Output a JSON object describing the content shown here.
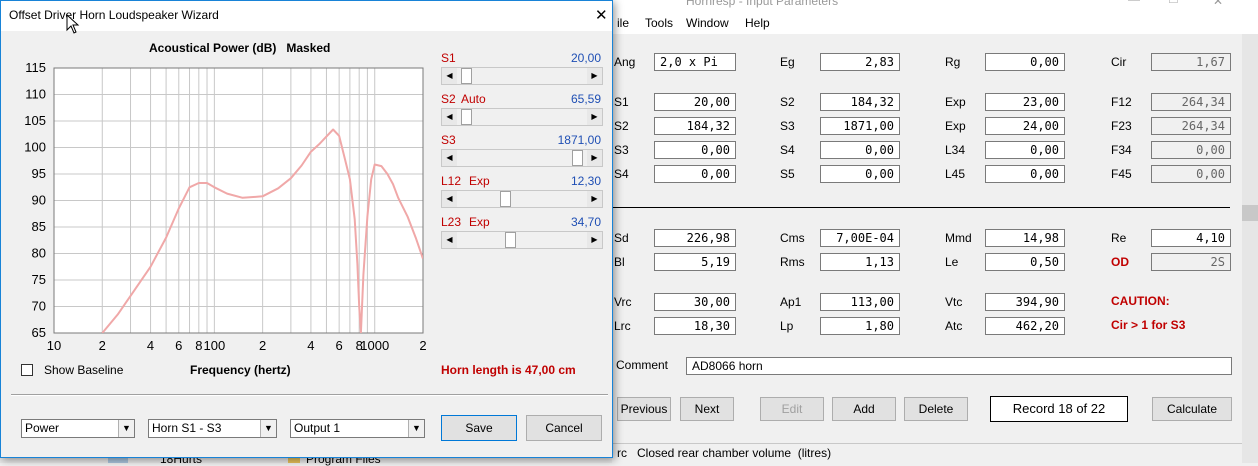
{
  "main_window": {
    "title": "Hornresp - Input Parameters",
    "menu": [
      "ile",
      "Tools",
      "Window",
      "Help"
    ],
    "rows": [
      {
        "cells": [
          {
            "label": "Ang",
            "value": "2,0 x Pi",
            "kind": "normal"
          },
          {
            "label": "Eg",
            "value": "2,83",
            "kind": "normal"
          },
          {
            "label": "Rg",
            "value": "0,00",
            "kind": "normal"
          },
          {
            "label": "Cir",
            "value": "1,67",
            "kind": "ro"
          }
        ]
      },
      {
        "cells": [
          {
            "label": "S1",
            "value": "20,00",
            "kind": "normal"
          },
          {
            "label": "S2",
            "value": "184,32",
            "kind": "normal"
          },
          {
            "label": "Exp",
            "value": "23,00",
            "kind": "normal"
          },
          {
            "label": "F12",
            "value": "264,34",
            "kind": "ro"
          }
        ]
      },
      {
        "cells": [
          {
            "label": "S2",
            "value": "184,32",
            "kind": "normal"
          },
          {
            "label": "S3",
            "value": "1871,00",
            "kind": "normal"
          },
          {
            "label": "Exp",
            "value": "24,00",
            "kind": "normal"
          },
          {
            "label": "F23",
            "value": "264,34",
            "kind": "ro"
          }
        ]
      },
      {
        "cells": [
          {
            "label": "S3",
            "value": "0,00",
            "kind": "normal"
          },
          {
            "label": "S4",
            "value": "0,00",
            "kind": "normal"
          },
          {
            "label": "L34",
            "value": "0,00",
            "kind": "normal"
          },
          {
            "label": "F34",
            "value": "0,00",
            "kind": "ro"
          }
        ]
      },
      {
        "cells": [
          {
            "label": "S4",
            "value": "0,00",
            "kind": "normal"
          },
          {
            "label": "S5",
            "value": "0,00",
            "kind": "normal"
          },
          {
            "label": "L45",
            "value": "0,00",
            "kind": "normal"
          },
          {
            "label": "F45",
            "value": "0,00",
            "kind": "ro"
          }
        ]
      },
      {
        "cells": [
          {
            "label": "Sd",
            "value": "226,98",
            "kind": "normal"
          },
          {
            "label": "Cms",
            "value": "7,00E-04",
            "kind": "normal"
          },
          {
            "label": "Mmd",
            "value": "14,98",
            "kind": "normal"
          },
          {
            "label": "Re",
            "value": "4,10",
            "kind": "normal"
          }
        ]
      },
      {
        "cells": [
          {
            "label": "Bl",
            "value": "5,19",
            "kind": "normal"
          },
          {
            "label": "Rms",
            "value": "1,13",
            "kind": "normal"
          },
          {
            "label": "Le",
            "value": "0,50",
            "kind": "normal"
          },
          {
            "label": "OD",
            "value": "2S",
            "kind": "ro-red"
          }
        ]
      },
      {
        "cells": [
          {
            "label": "Vrc",
            "value": "30,00",
            "kind": "normal"
          },
          {
            "label": "Ap1",
            "value": "113,00",
            "kind": "normal"
          },
          {
            "label": "Vtc",
            "value": "394,90",
            "kind": "normal"
          }
        ]
      },
      {
        "cells": [
          {
            "label": "Lrc",
            "value": "18,30",
            "kind": "normal"
          },
          {
            "label": "Lp",
            "value": "1,80",
            "kind": "normal"
          },
          {
            "label": "Atc",
            "value": "462,20",
            "kind": "normal"
          }
        ]
      }
    ],
    "caution": "CAUTION:",
    "caution_detail": "Cir > 1 for S3",
    "comment_label": "Comment",
    "comment_value": "AD8066 horn",
    "buttons": {
      "previous": "Previous",
      "next": "Next",
      "edit": "Edit",
      "add": "Add",
      "delete": "Delete",
      "calculate": "Calculate"
    },
    "record": "Record 18 of 22",
    "status": "rc   Closed rear chamber volume  (litres)"
  },
  "wizard": {
    "title": "Offset Driver Horn Loudspeaker Wizard",
    "close_glyph": "✕",
    "chart_title": "Acoustical Power (dB)   Masked",
    "show_baseline": "Show Baseline",
    "horn_length": "Horn length is 47,00 cm",
    "sliders": [
      {
        "name": "S1",
        "mode": "",
        "value": "20,00",
        "pos": 0.03
      },
      {
        "name": "S2",
        "mode": "Auto",
        "value": "65,59",
        "pos": 0.03
      },
      {
        "name": "S3",
        "mode": "",
        "value": "1871,00",
        "pos": 0.97
      },
      {
        "name": "L12",
        "mode": "Exp",
        "value": "12,30",
        "pos": 0.36
      },
      {
        "name": "L23",
        "mode": "Exp",
        "value": "34,70",
        "pos": 0.4
      }
    ],
    "dropdowns": [
      "Power",
      "Horn S1 - S3",
      "Output 1"
    ],
    "save": "Save",
    "cancel": "Cancel"
  },
  "background": {
    "items": [
      "18Hurts",
      "Program Files"
    ]
  },
  "chart_data": {
    "type": "line",
    "title": "Acoustical Power (dB)   Masked",
    "xlabel": "Frequency (hertz)",
    "ylabel": "",
    "xscale": "log",
    "xlim": [
      10,
      2000
    ],
    "ylim": [
      65,
      115
    ],
    "yticks": [
      65,
      70,
      75,
      80,
      85,
      90,
      95,
      100,
      105,
      110,
      115
    ],
    "xtick_labels": [
      {
        "v": 10,
        "t": "10"
      },
      {
        "v": 20,
        "t": "2"
      },
      {
        "v": 40,
        "t": "4"
      },
      {
        "v": 60,
        "t": "6"
      },
      {
        "v": 80,
        "t": "8"
      },
      {
        "v": 100,
        "t": "100"
      },
      {
        "v": 200,
        "t": "2"
      },
      {
        "v": 400,
        "t": "4"
      },
      {
        "v": 600,
        "t": "6"
      },
      {
        "v": 800,
        "t": "8"
      },
      {
        "v": 1000,
        "t": "1000"
      },
      {
        "v": 2000,
        "t": "2"
      }
    ],
    "grid": true,
    "line_color": "#f0a8a8",
    "x": [
      20,
      25,
      30,
      40,
      50,
      60,
      70,
      80,
      90,
      100,
      120,
      150,
      200,
      250,
      300,
      350,
      400,
      450,
      500,
      550,
      600,
      650,
      700,
      750,
      780,
      800,
      820,
      850,
      900,
      950,
      1000,
      1100,
      1200,
      1300,
      1400,
      1600,
      1800,
      2000
    ],
    "y": [
      65,
      68.5,
      72,
      77.5,
      83,
      88.5,
      92.5,
      93.3,
      93.3,
      92.5,
      91.3,
      90.5,
      90.8,
      92.3,
      94.2,
      96.6,
      99.2,
      100.6,
      102.1,
      103.4,
      102.2,
      98,
      94,
      86.5,
      78,
      70,
      65,
      76,
      87,
      94,
      96.8,
      96.5,
      95,
      93.1,
      90.5,
      87,
      83,
      79
    ]
  }
}
